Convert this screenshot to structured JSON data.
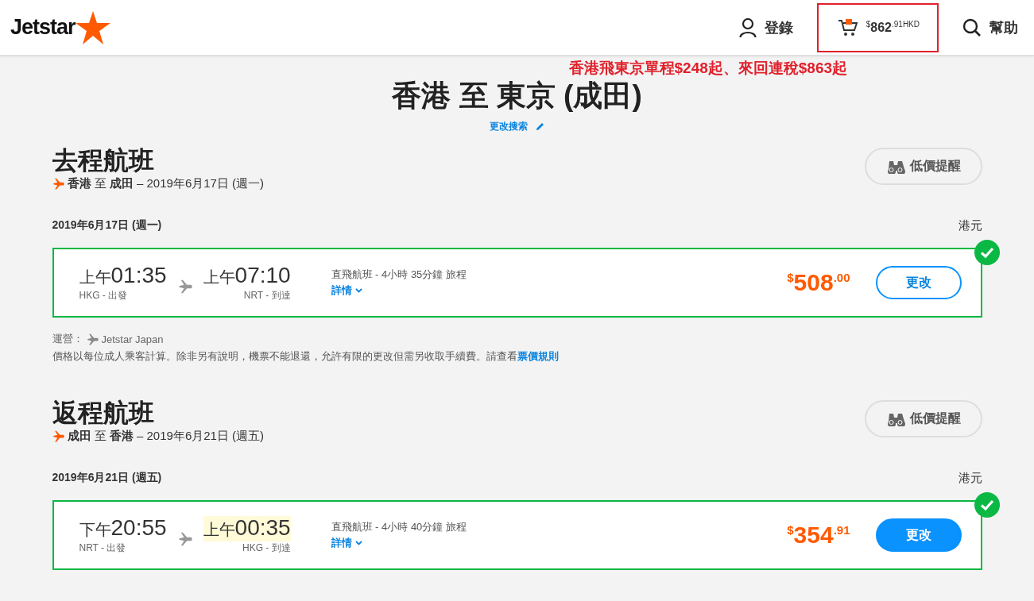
{
  "header": {
    "logo": "Jetstar",
    "login": "登錄",
    "cart": {
      "currency": "$",
      "whole": "862",
      "cents": ".91",
      "code": "HKD",
      "highlighted": true
    },
    "help": "幫助"
  },
  "annotation": "香港飛東京單程$248起、來回連稅$863起",
  "title": "香港 至 東京 (成田)",
  "change_search": "更改搜索",
  "sections": [
    {
      "heading": "去程航班",
      "route": "**香港** 至 **成田** – 2019年6月17日 (週一)",
      "alert_button": "低價提醒",
      "date": "2019年6月17日 (週一)",
      "currency_label": "港元",
      "flight": {
        "selected": true,
        "dep_period": "上午",
        "dep_time": "01:35",
        "dep_label": "HKG - 出發",
        "arr_period": "上午",
        "arr_time": "07:10",
        "arr_label": "NRT - 到達",
        "arr_highlighted": false,
        "info": "直飛航班 - 4小時 35分鐘 旅程",
        "details": "詳情",
        "price_symbol": "$",
        "price_whole": "508",
        "price_cents": ".00",
        "button": "更改",
        "button_filled": false
      },
      "operator_label": "運營：",
      "operator": "Jetstar Japan",
      "note": "價格以每位成人乘客計算。除非另有說明，機票不能退還，允許有限的更改但需另收取手續費。請查看",
      "note_link": "票價規則"
    },
    {
      "heading": "返程航班",
      "route": "**成田** 至 **香港** – 2019年6月21日 (週五)",
      "alert_button": "低價提醒",
      "date": "2019年6月21日 (週五)",
      "currency_label": "港元",
      "flight": {
        "selected": true,
        "dep_period": "下午",
        "dep_time": "20:55",
        "dep_label": "NRT - 出發",
        "arr_period": "上午",
        "arr_time": "00:35",
        "arr_label": "HKG - 到達",
        "arr_highlighted": true,
        "info": "直飛航班 - 4小時 40分鐘 旅程",
        "details": "詳情",
        "price_symbol": "$",
        "price_whole": "354",
        "price_cents": ".91",
        "button": "更改",
        "button_filled": true
      }
    }
  ]
}
